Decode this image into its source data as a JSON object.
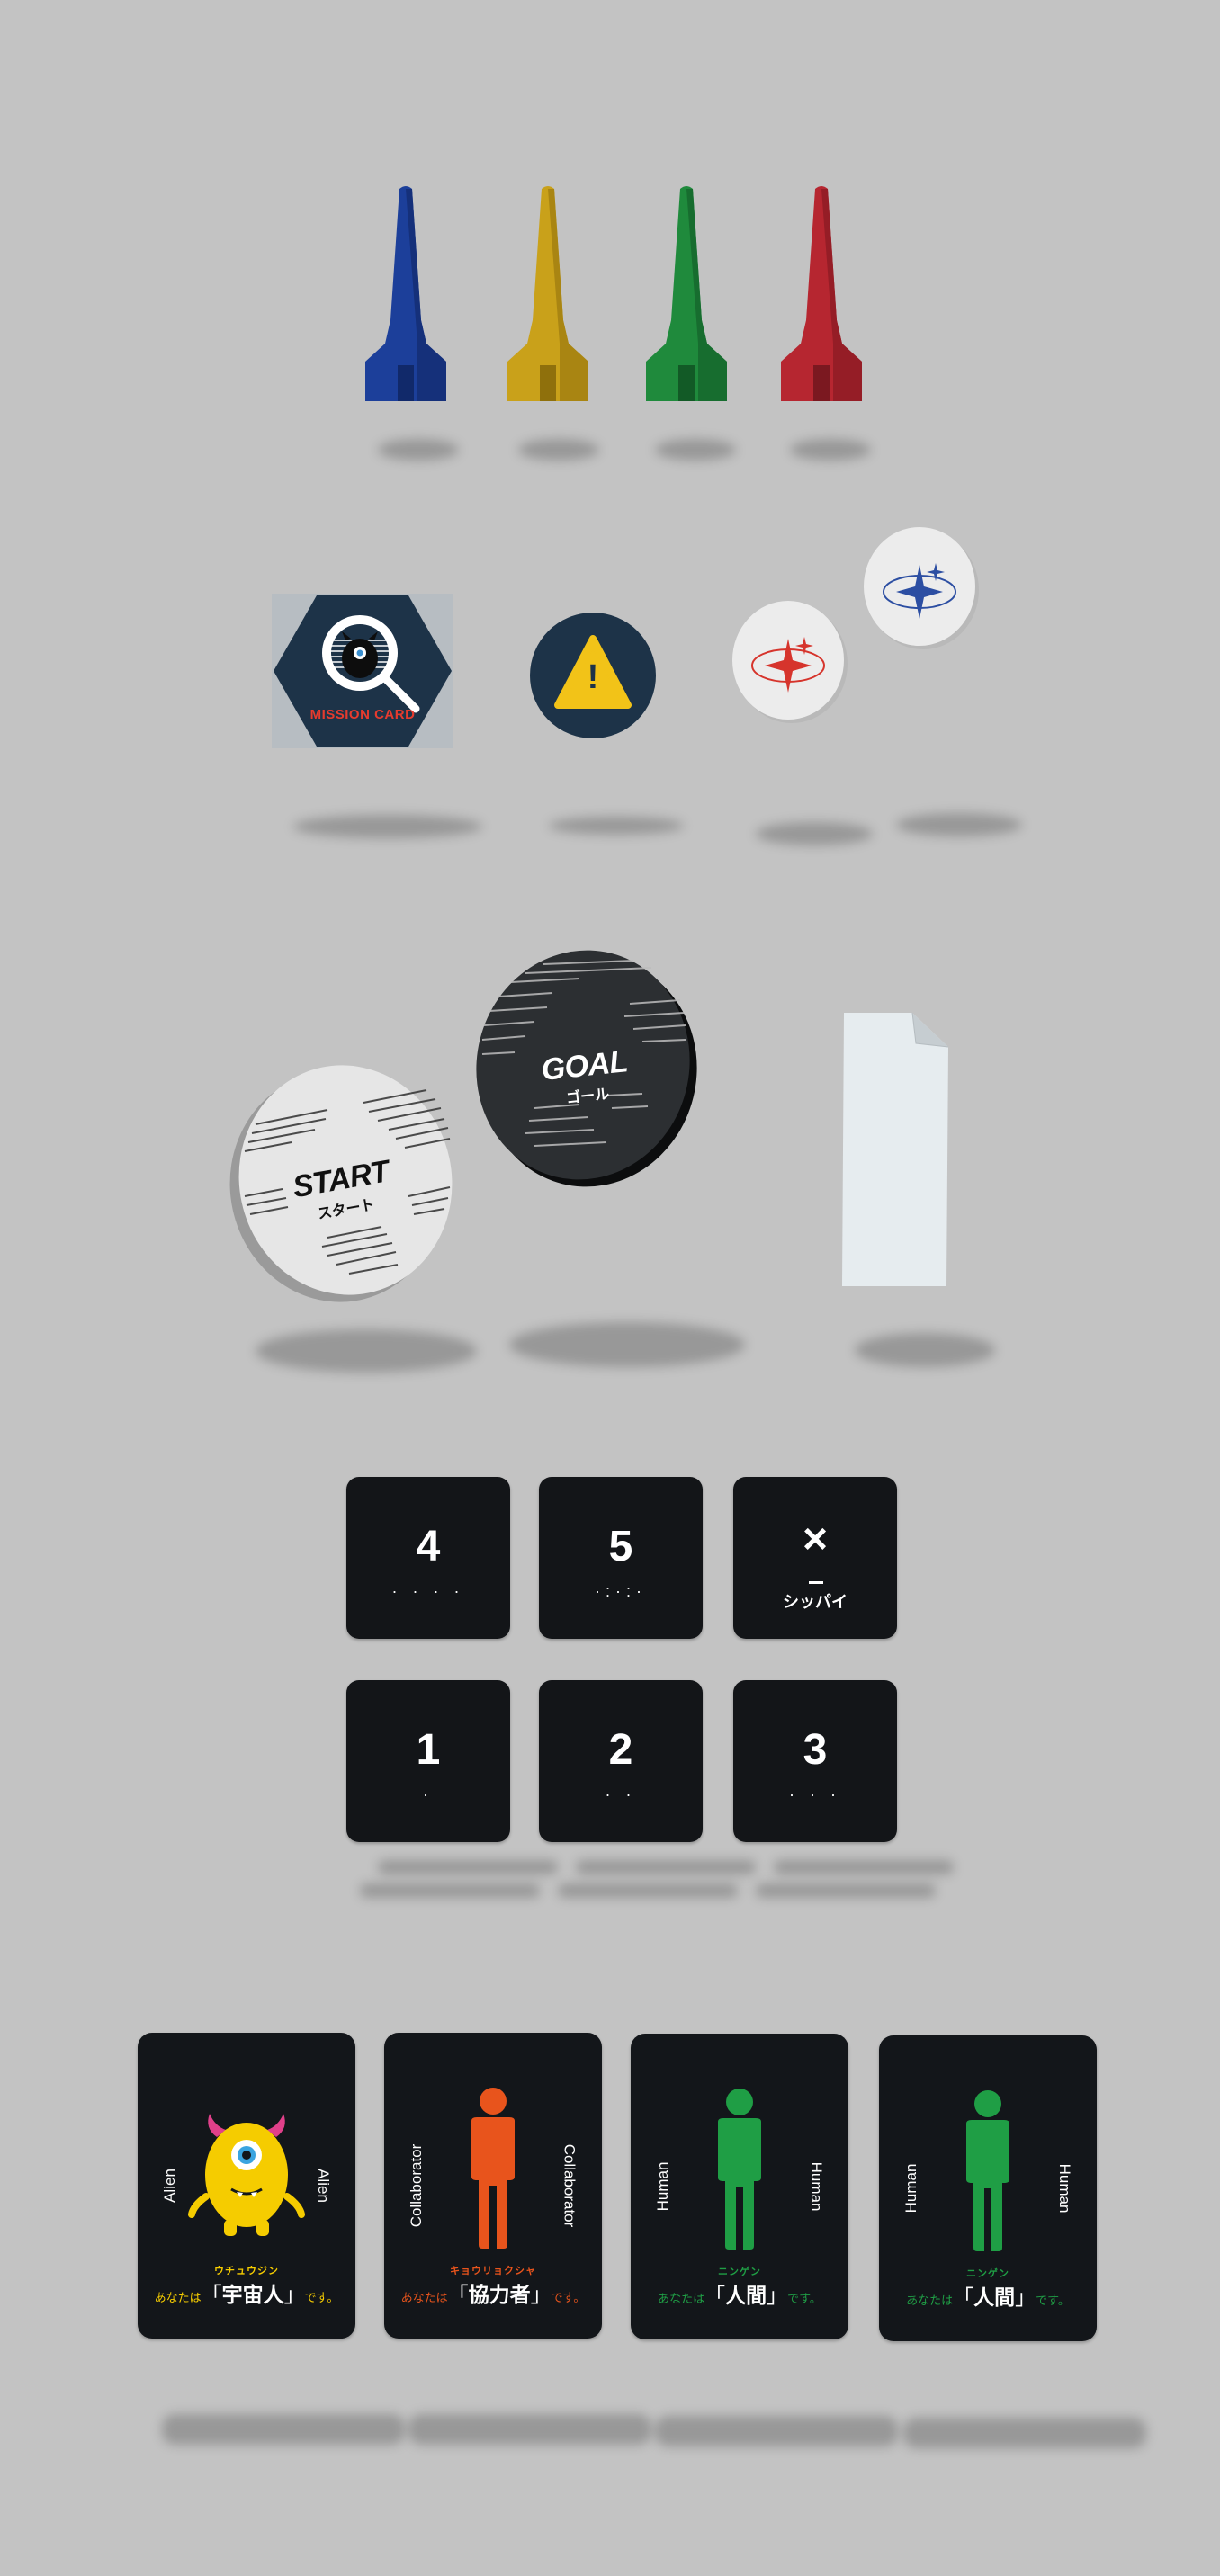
{
  "pieces": [
    {
      "name": "blue",
      "color": "#1c3f9a"
    },
    {
      "name": "yellow",
      "color": "#c9a11a"
    },
    {
      "name": "green",
      "color": "#1f8a3c"
    },
    {
      "name": "red",
      "color": "#b62630"
    }
  ],
  "mission_token": {
    "label": "MISSION CARD",
    "bg": "#1d3348"
  },
  "warning_token": {
    "symbol": "!",
    "bg": "#1d3348",
    "accent": "#f2c318"
  },
  "star_tokens": [
    {
      "name": "red-star-token",
      "accent": "#d6342c"
    },
    {
      "name": "blue-star-token",
      "accent": "#2c4ea2"
    }
  ],
  "start_disc": {
    "title": "START",
    "subtitle": "スタート"
  },
  "goal_disc": {
    "title": "GOAL",
    "subtitle": "ゴール"
  },
  "dice": [
    {
      "number": "4",
      "pips": "· · · ·",
      "sub": ""
    },
    {
      "number": "5",
      "pips": "·:·:·",
      "sub": ""
    },
    {
      "number": "×",
      "pips": "",
      "sub": "シッパイ"
    },
    {
      "number": "1",
      "pips": "·",
      "sub": ""
    },
    {
      "number": "2",
      "pips": "· ·",
      "sub": ""
    },
    {
      "number": "3",
      "pips": "· · ·",
      "sub": ""
    }
  ],
  "cards": [
    {
      "side": "Alien",
      "ruby": "ウチュウジン",
      "prefix": "あなたは",
      "role": "宇宙人",
      "suffix": "です。",
      "color": "#f5cc00",
      "figure": "alien"
    },
    {
      "side": "Collaborator",
      "ruby": "キョウリョクシャ",
      "prefix": "あなたは",
      "role": "協力者",
      "suffix": "です。",
      "color": "#e8541c",
      "figure": "person"
    },
    {
      "side": "Human",
      "ruby": "ニンゲン",
      "prefix": "あなたは",
      "role": "人間",
      "suffix": "です。",
      "color": "#1f9e45",
      "figure": "person"
    },
    {
      "side": "Human",
      "ruby": "ニンゲン",
      "prefix": "あなたは",
      "role": "人間",
      "suffix": "です。",
      "color": "#1f9e45",
      "figure": "person"
    }
  ],
  "bracket_open": "「",
  "bracket_close": "」"
}
